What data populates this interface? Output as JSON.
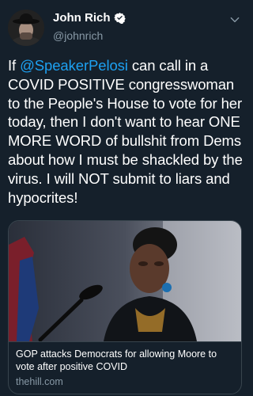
{
  "author": {
    "display_name": "John Rich",
    "handle": "@johnrich",
    "verified": true
  },
  "icons": {
    "verified": "verified-badge-icon",
    "menu": "chevron-down-icon",
    "avatar": "user-avatar"
  },
  "tweet": {
    "text_before": "If ",
    "mention": "@SpeakerPelosi",
    "text_after": " can call in a COVID POSITIVE congresswoman to the People's House to vote for her today, then I don't want to hear ONE MORE WORD of bullshit from Dems about how I must be shackled by the virus. I will NOT submit to liars and hypocrites!"
  },
  "card": {
    "title": "GOP attacks Democrats for allowing Moore to vote after positive COVID",
    "domain": "thehill.com"
  },
  "colors": {
    "background": "#15202b",
    "text": "#ffffff",
    "secondary": "#8899a6",
    "mention": "#1da1f2",
    "border": "#38444d"
  }
}
